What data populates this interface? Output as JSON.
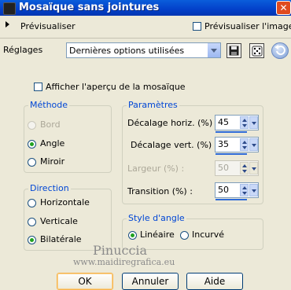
{
  "window": {
    "title": "Mosaïque sans jointures"
  },
  "preview": {
    "label": "Prévisualiser",
    "checkbox_label": "Prévisualiser l'image"
  },
  "settings": {
    "label": "Réglages",
    "selected": "Dernières options utilisées"
  },
  "show_preview": {
    "label": "Afficher l'aperçu de la mosaïque"
  },
  "method": {
    "title": "Méthode",
    "options": [
      {
        "label": "Bord",
        "selected": false,
        "disabled": true
      },
      {
        "label": "Angle",
        "selected": true,
        "disabled": false
      },
      {
        "label": "Miroir",
        "selected": false,
        "disabled": false
      }
    ]
  },
  "direction": {
    "title": "Direction",
    "options": [
      {
        "label": "Horizontale",
        "selected": false
      },
      {
        "label": "Verticale",
        "selected": false
      },
      {
        "label": "Bilatérale",
        "selected": true
      }
    ]
  },
  "params": {
    "title": "Paramètres",
    "fields": [
      {
        "label": "Décalage horiz. (%) :",
        "value": "45",
        "disabled": false
      },
      {
        "label": "Décalage vert. (%) :",
        "value": "35",
        "disabled": false
      },
      {
        "label": "Largeur (%) :",
        "value": "50",
        "disabled": true
      },
      {
        "label": "Transition (%) :",
        "value": "50",
        "disabled": false
      }
    ]
  },
  "angle_style": {
    "title": "Style d'angle",
    "options": [
      {
        "label": "Linéaire",
        "selected": true
      },
      {
        "label": "Incurvé",
        "selected": false
      }
    ]
  },
  "watermark": {
    "name": "Pinuccia",
    "url": "www.maidiregrafica.eu"
  },
  "buttons": {
    "ok": "OK",
    "cancel": "Annuler",
    "help": "Aide"
  }
}
